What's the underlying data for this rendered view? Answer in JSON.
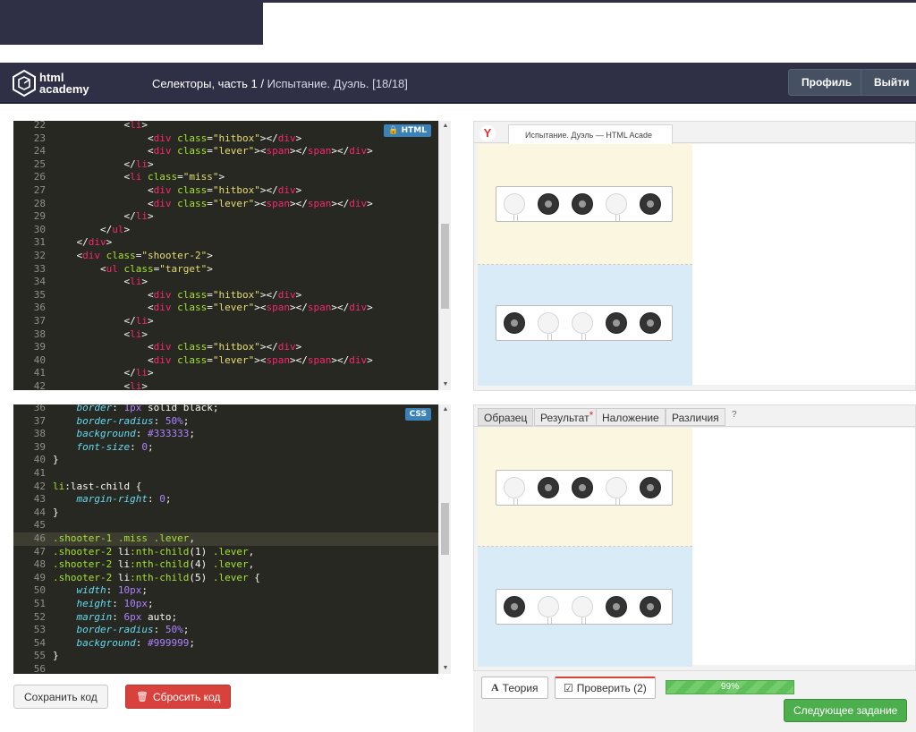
{
  "header": {
    "logo_line1": "html",
    "logo_line2": "academy",
    "breadcrumb_main": "Селекторы, часть 1 /",
    "breadcrumb_sub": "Испытание. Дуэль.",
    "breadcrumb_count": "[18/18]",
    "profile_label": "Профиль",
    "logout_label": "Выйти"
  },
  "html_editor": {
    "badge": "HTML",
    "lines": [
      {
        "n": "22",
        "indent": "            ",
        "parts": [
          [
            "w",
            "<"
          ],
          [
            "t",
            "li"
          ],
          [
            "w",
            ">"
          ]
        ]
      },
      {
        "n": "23",
        "indent": "                ",
        "parts": [
          [
            "w",
            "<"
          ],
          [
            "t",
            "div"
          ],
          [
            "w",
            " "
          ],
          [
            "a",
            "class"
          ],
          [
            "w",
            "="
          ],
          [
            "s",
            "\"hitbox\""
          ],
          [
            "w",
            "></"
          ],
          [
            "t",
            "div"
          ],
          [
            "w",
            ">"
          ]
        ]
      },
      {
        "n": "24",
        "indent": "                ",
        "parts": [
          [
            "w",
            "<"
          ],
          [
            "t",
            "div"
          ],
          [
            "w",
            " "
          ],
          [
            "a",
            "class"
          ],
          [
            "w",
            "="
          ],
          [
            "s",
            "\"lever\""
          ],
          [
            "w",
            "><"
          ],
          [
            "t",
            "span"
          ],
          [
            "w",
            "></"
          ],
          [
            "t",
            "span"
          ],
          [
            "w",
            "></"
          ],
          [
            "t",
            "div"
          ],
          [
            "w",
            ">"
          ]
        ]
      },
      {
        "n": "25",
        "indent": "            ",
        "parts": [
          [
            "w",
            "</"
          ],
          [
            "t",
            "li"
          ],
          [
            "w",
            ">"
          ]
        ]
      },
      {
        "n": "26",
        "indent": "            ",
        "parts": [
          [
            "w",
            "<"
          ],
          [
            "t",
            "li"
          ],
          [
            "w",
            " "
          ],
          [
            "a",
            "class"
          ],
          [
            "w",
            "="
          ],
          [
            "s",
            "\"miss\""
          ],
          [
            "w",
            ">"
          ]
        ]
      },
      {
        "n": "27",
        "indent": "                ",
        "parts": [
          [
            "w",
            "<"
          ],
          [
            "t",
            "div"
          ],
          [
            "w",
            " "
          ],
          [
            "a",
            "class"
          ],
          [
            "w",
            "="
          ],
          [
            "s",
            "\"hitbox\""
          ],
          [
            "w",
            "></"
          ],
          [
            "t",
            "div"
          ],
          [
            "w",
            ">"
          ]
        ]
      },
      {
        "n": "28",
        "indent": "                ",
        "parts": [
          [
            "w",
            "<"
          ],
          [
            "t",
            "div"
          ],
          [
            "w",
            " "
          ],
          [
            "a",
            "class"
          ],
          [
            "w",
            "="
          ],
          [
            "s",
            "\"lever\""
          ],
          [
            "w",
            "><"
          ],
          [
            "t",
            "span"
          ],
          [
            "w",
            "></"
          ],
          [
            "t",
            "span"
          ],
          [
            "w",
            "></"
          ],
          [
            "t",
            "div"
          ],
          [
            "w",
            ">"
          ]
        ]
      },
      {
        "n": "29",
        "indent": "            ",
        "parts": [
          [
            "w",
            "</"
          ],
          [
            "t",
            "li"
          ],
          [
            "w",
            ">"
          ]
        ]
      },
      {
        "n": "30",
        "indent": "        ",
        "parts": [
          [
            "w",
            "</"
          ],
          [
            "t",
            "ul"
          ],
          [
            "w",
            ">"
          ]
        ]
      },
      {
        "n": "31",
        "indent": "    ",
        "parts": [
          [
            "w",
            "</"
          ],
          [
            "t",
            "div"
          ],
          [
            "w",
            ">"
          ]
        ]
      },
      {
        "n": "32",
        "indent": "    ",
        "parts": [
          [
            "w",
            "<"
          ],
          [
            "t",
            "div"
          ],
          [
            "w",
            " "
          ],
          [
            "a",
            "class"
          ],
          [
            "w",
            "="
          ],
          [
            "s",
            "\"shooter-2\""
          ],
          [
            "w",
            ">"
          ]
        ]
      },
      {
        "n": "33",
        "indent": "        ",
        "parts": [
          [
            "w",
            "<"
          ],
          [
            "t",
            "ul"
          ],
          [
            "w",
            " "
          ],
          [
            "a",
            "class"
          ],
          [
            "w",
            "="
          ],
          [
            "s",
            "\"target\""
          ],
          [
            "w",
            ">"
          ]
        ]
      },
      {
        "n": "34",
        "indent": "            ",
        "parts": [
          [
            "w",
            "<"
          ],
          [
            "t",
            "li"
          ],
          [
            "w",
            ">"
          ]
        ]
      },
      {
        "n": "35",
        "indent": "                ",
        "parts": [
          [
            "w",
            "<"
          ],
          [
            "t",
            "div"
          ],
          [
            "w",
            " "
          ],
          [
            "a",
            "class"
          ],
          [
            "w",
            "="
          ],
          [
            "s",
            "\"hitbox\""
          ],
          [
            "w",
            "></"
          ],
          [
            "t",
            "div"
          ],
          [
            "w",
            ">"
          ]
        ]
      },
      {
        "n": "36",
        "indent": "                ",
        "parts": [
          [
            "w",
            "<"
          ],
          [
            "t",
            "div"
          ],
          [
            "w",
            " "
          ],
          [
            "a",
            "class"
          ],
          [
            "w",
            "="
          ],
          [
            "s",
            "\"lever\""
          ],
          [
            "w",
            "><"
          ],
          [
            "t",
            "span"
          ],
          [
            "w",
            "></"
          ],
          [
            "t",
            "span"
          ],
          [
            "w",
            "></"
          ],
          [
            "t",
            "div"
          ],
          [
            "w",
            ">"
          ]
        ]
      },
      {
        "n": "37",
        "indent": "            ",
        "parts": [
          [
            "w",
            "</"
          ],
          [
            "t",
            "li"
          ],
          [
            "w",
            ">"
          ]
        ]
      },
      {
        "n": "38",
        "indent": "            ",
        "parts": [
          [
            "w",
            "<"
          ],
          [
            "t",
            "li"
          ],
          [
            "w",
            ">"
          ]
        ]
      },
      {
        "n": "39",
        "indent": "                ",
        "parts": [
          [
            "w",
            "<"
          ],
          [
            "t",
            "div"
          ],
          [
            "w",
            " "
          ],
          [
            "a",
            "class"
          ],
          [
            "w",
            "="
          ],
          [
            "s",
            "\"hitbox\""
          ],
          [
            "w",
            "></"
          ],
          [
            "t",
            "div"
          ],
          [
            "w",
            ">"
          ]
        ]
      },
      {
        "n": "40",
        "indent": "                ",
        "parts": [
          [
            "w",
            "<"
          ],
          [
            "t",
            "div"
          ],
          [
            "w",
            " "
          ],
          [
            "a",
            "class"
          ],
          [
            "w",
            "="
          ],
          [
            "s",
            "\"lever\""
          ],
          [
            "w",
            "><"
          ],
          [
            "t",
            "span"
          ],
          [
            "w",
            "></"
          ],
          [
            "t",
            "span"
          ],
          [
            "w",
            "></"
          ],
          [
            "t",
            "div"
          ],
          [
            "w",
            ">"
          ]
        ]
      },
      {
        "n": "41",
        "indent": "            ",
        "parts": [
          [
            "w",
            "</"
          ],
          [
            "t",
            "li"
          ],
          [
            "w",
            ">"
          ]
        ]
      },
      {
        "n": "42",
        "indent": "            ",
        "parts": [
          [
            "w",
            "<"
          ],
          [
            "t",
            "li"
          ],
          [
            "w",
            ">"
          ]
        ]
      }
    ]
  },
  "css_editor": {
    "badge": "CSS",
    "lines": [
      {
        "n": "36",
        "indent": "    ",
        "parts": [
          [
            "p",
            "border"
          ],
          [
            "w",
            ": "
          ],
          [
            "n",
            "1px"
          ],
          [
            "w",
            " solid black;"
          ]
        ]
      },
      {
        "n": "37",
        "indent": "    ",
        "parts": [
          [
            "p",
            "border-radius"
          ],
          [
            "w",
            ": "
          ],
          [
            "n",
            "50%"
          ],
          [
            "w",
            ";"
          ]
        ]
      },
      {
        "n": "38",
        "indent": "    ",
        "parts": [
          [
            "p",
            "background"
          ],
          [
            "w",
            ": "
          ],
          [
            "n",
            "#333333"
          ],
          [
            "w",
            ";"
          ]
        ]
      },
      {
        "n": "39",
        "indent": "    ",
        "parts": [
          [
            "p",
            "font-size"
          ],
          [
            "w",
            ": "
          ],
          [
            "n",
            "0"
          ],
          [
            "w",
            ";"
          ]
        ]
      },
      {
        "n": "40",
        "indent": "",
        "parts": [
          [
            "w",
            "}"
          ]
        ]
      },
      {
        "n": "41",
        "indent": "",
        "parts": []
      },
      {
        "n": "42",
        "indent": "",
        "parts": [
          [
            "a",
            "li"
          ],
          [
            "w",
            ":last-child {"
          ]
        ]
      },
      {
        "n": "43",
        "indent": "    ",
        "parts": [
          [
            "p",
            "margin-right"
          ],
          [
            "w",
            ": "
          ],
          [
            "n",
            "0"
          ],
          [
            "w",
            ";"
          ]
        ]
      },
      {
        "n": "44",
        "indent": "",
        "parts": [
          [
            "w",
            "}"
          ]
        ]
      },
      {
        "n": "45",
        "indent": "",
        "parts": []
      },
      {
        "n": "46",
        "indent": "",
        "parts": [
          [
            "a",
            ".shooter-1 .miss .lever"
          ],
          [
            "w",
            ","
          ]
        ]
      },
      {
        "n": "47",
        "indent": "",
        "parts": [
          [
            "a",
            ".shooter-2 "
          ],
          [
            "w",
            "li"
          ],
          [
            "a",
            ":nth-child"
          ],
          [
            "w",
            "(1) "
          ],
          [
            "a",
            ".lever"
          ],
          [
            "w",
            ","
          ]
        ]
      },
      {
        "n": "48",
        "indent": "",
        "parts": [
          [
            "a",
            ".shooter-2 "
          ],
          [
            "w",
            "li"
          ],
          [
            "a",
            ":nth-child"
          ],
          [
            "w",
            "(4) "
          ],
          [
            "a",
            ".lever"
          ],
          [
            "w",
            ","
          ]
        ]
      },
      {
        "n": "49",
        "indent": "",
        "parts": [
          [
            "a",
            ".shooter-2 "
          ],
          [
            "w",
            "li"
          ],
          [
            "a",
            ":nth-child"
          ],
          [
            "w",
            "(5) "
          ],
          [
            "a",
            ".lever"
          ],
          [
            "w",
            " {"
          ]
        ]
      },
      {
        "n": "50",
        "indent": "    ",
        "parts": [
          [
            "p",
            "width"
          ],
          [
            "w",
            ": "
          ],
          [
            "n",
            "10px"
          ],
          [
            "w",
            ";"
          ]
        ]
      },
      {
        "n": "51",
        "indent": "    ",
        "parts": [
          [
            "p",
            "height"
          ],
          [
            "w",
            ": "
          ],
          [
            "n",
            "10px"
          ],
          [
            "w",
            ";"
          ]
        ]
      },
      {
        "n": "52",
        "indent": "    ",
        "parts": [
          [
            "p",
            "margin"
          ],
          [
            "w",
            ": "
          ],
          [
            "n",
            "6px"
          ],
          [
            "w",
            " auto;"
          ]
        ]
      },
      {
        "n": "53",
        "indent": "    ",
        "parts": [
          [
            "p",
            "border-radius"
          ],
          [
            "w",
            ": "
          ],
          [
            "n",
            "50%"
          ],
          [
            "w",
            ";"
          ]
        ]
      },
      {
        "n": "54",
        "indent": "    ",
        "parts": [
          [
            "p",
            "background"
          ],
          [
            "w",
            ": "
          ],
          [
            "n",
            "#999999"
          ],
          [
            "w",
            ";"
          ]
        ]
      },
      {
        "n": "55",
        "indent": "",
        "parts": [
          [
            "w",
            "}"
          ]
        ]
      },
      {
        "n": "56",
        "indent": "",
        "parts": []
      }
    ]
  },
  "editor_buttons": {
    "save_label": "Сохранить код",
    "reset_label": "Сбросить код"
  },
  "browser": {
    "tab_title": "Испытание. Дуэль — HTML Acade",
    "browser_icon": "yandex-icon"
  },
  "targets": {
    "row1": [
      "miss",
      "hit",
      "hit",
      "miss",
      "hit"
    ],
    "row2": [
      "hit",
      "miss",
      "miss",
      "hit",
      "hit"
    ]
  },
  "view_tabs": {
    "sample": "Образец",
    "result": "Результат",
    "result_star": "*",
    "overlay": "Наложение",
    "diff": "Различия",
    "help": "?"
  },
  "bottom": {
    "theory_icon": "A",
    "theory_label": "Теория",
    "check_label": "Проверить (2)",
    "progress_text": "99%",
    "progress_value": 99,
    "next_label": "Следующее задание"
  }
}
